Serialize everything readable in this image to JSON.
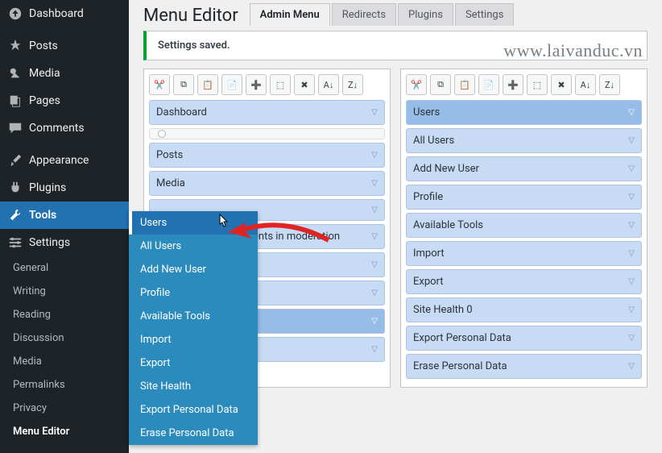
{
  "sidebar": {
    "items": [
      {
        "label": "Dashboard",
        "icon": "dash"
      },
      {
        "label": "Posts",
        "icon": "pin"
      },
      {
        "label": "Media",
        "icon": "media"
      },
      {
        "label": "Pages",
        "icon": "page"
      },
      {
        "label": "Comments",
        "icon": "comment"
      },
      {
        "label": "Appearance",
        "icon": "brush"
      },
      {
        "label": "Plugins",
        "icon": "plug"
      },
      {
        "label": "Tools",
        "icon": "wrench"
      },
      {
        "label": "Settings",
        "icon": "sliders"
      }
    ],
    "subs": [
      "General",
      "Writing",
      "Reading",
      "Discussion",
      "Media",
      "Permalinks",
      "Privacy",
      "Menu Editor"
    ]
  },
  "flyout": [
    "Users",
    "All Users",
    "Add New User",
    "Profile",
    "Available Tools",
    "Import",
    "Export",
    "Site Health",
    "Export Personal Data",
    "Erase Personal Data"
  ],
  "header": {
    "title": "Menu Editor",
    "tabs": [
      "Admin Menu",
      "Redirects",
      "Plugins",
      "Settings"
    ]
  },
  "notice": "Settings saved.",
  "watermark": "www.laivanduc.vn",
  "leftMenu": [
    "Dashboard",
    "",
    "Posts",
    "Media",
    "",
    "",
    "ents in moderation",
    "",
    "",
    "",
    "",
    ""
  ],
  "rightMenu": [
    "Users",
    "All Users",
    "Add New User",
    "Profile",
    "Available Tools",
    "Import",
    "Export",
    "Site Health 0",
    "Export Personal Data",
    "Erase Personal Data"
  ],
  "toolbar": [
    "cut",
    "copy",
    "paste",
    "new",
    "add",
    "hide",
    "del",
    "az",
    "za"
  ]
}
